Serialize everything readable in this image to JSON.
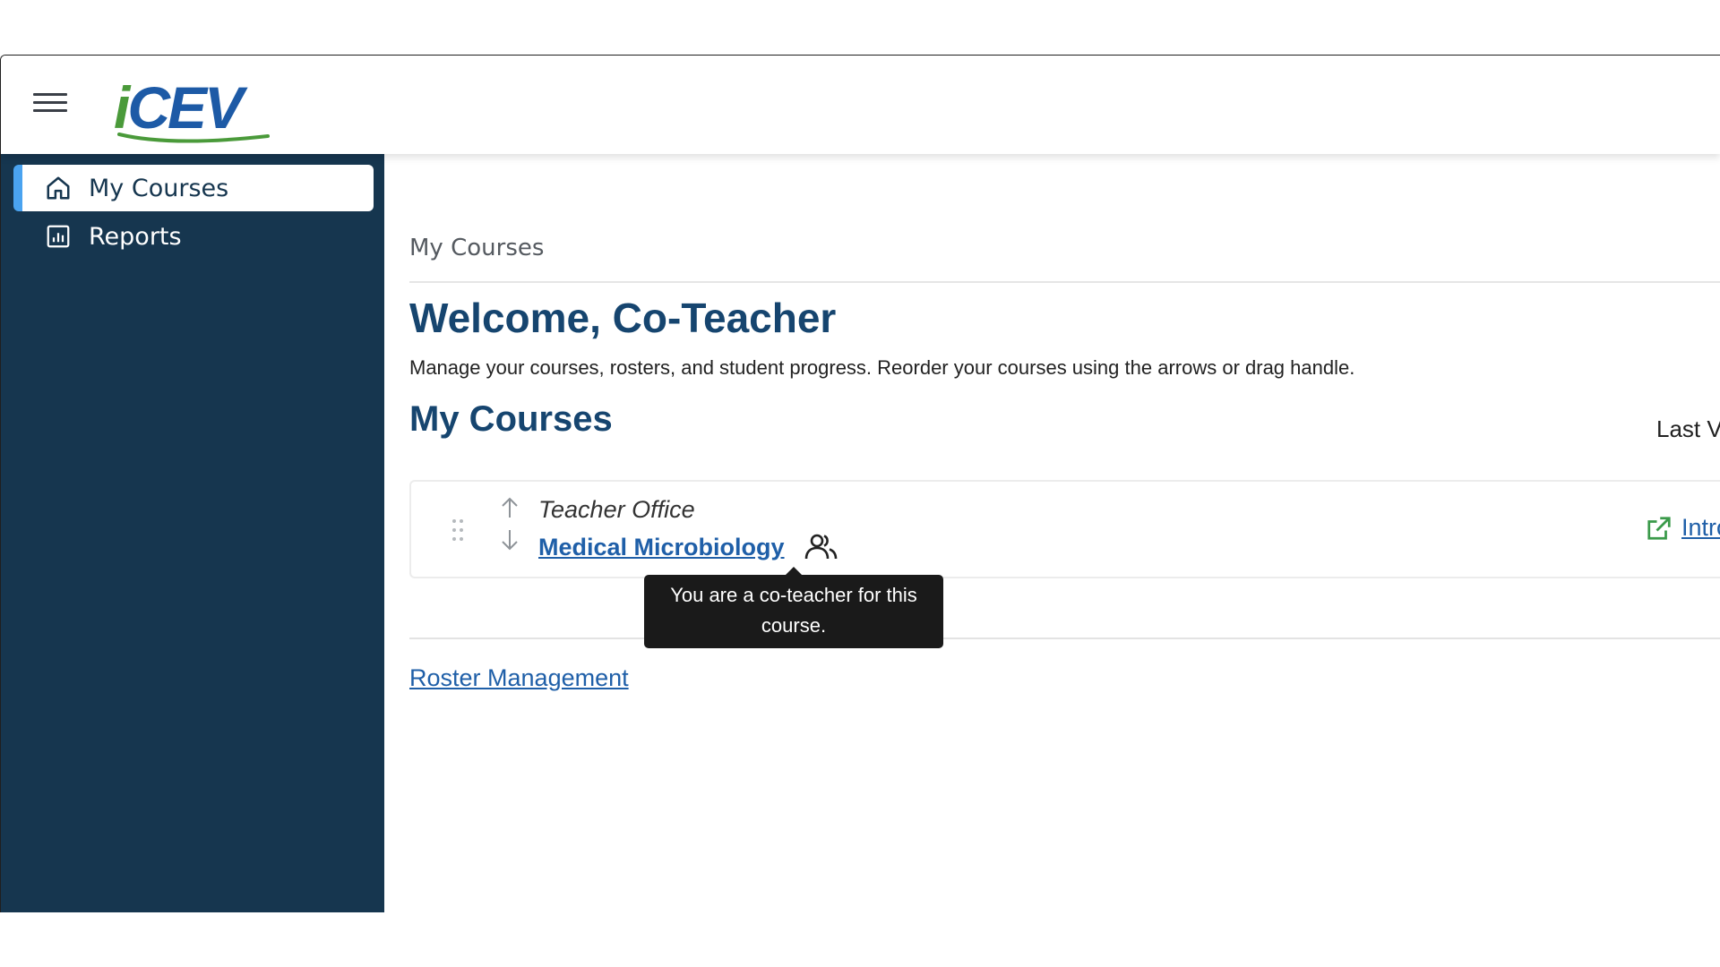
{
  "header": {
    "logo_text_i": "i",
    "logo_text_rest": "CEV",
    "menu_icon": "hamburger-menu-icon",
    "colors": {
      "logo_blue": "#1d5aa6",
      "logo_green": "#4a9a3a"
    }
  },
  "sidebar": {
    "background": "#16364f",
    "active_accent": "#4aa3f0",
    "items": [
      {
        "label": "My Courses",
        "icon": "home-icon",
        "active": true
      },
      {
        "label": "Reports",
        "icon": "bar-chart-icon",
        "active": false
      }
    ]
  },
  "main": {
    "breadcrumb": "My Courses",
    "welcome": "Welcome, Co-Teacher",
    "subtitle": "Manage your courses, rosters, and student progress. Reorder your courses using the arrows or drag handle.",
    "courses_heading": "My Courses",
    "last_viewed_label": "Last V",
    "courses": [
      {
        "category": "Teacher Office",
        "title": "Medical Microbiology",
        "role_icon": "co-teacher-icon",
        "external_link_label": "Introdu",
        "external_link_icon": "external-link-icon"
      }
    ],
    "tooltip": "You are a co-teacher for this course.",
    "roster_link": "Roster Management",
    "colors": {
      "heading": "#16456f",
      "link": "#1f5fa8",
      "external_icon": "#3a9a4a"
    }
  }
}
